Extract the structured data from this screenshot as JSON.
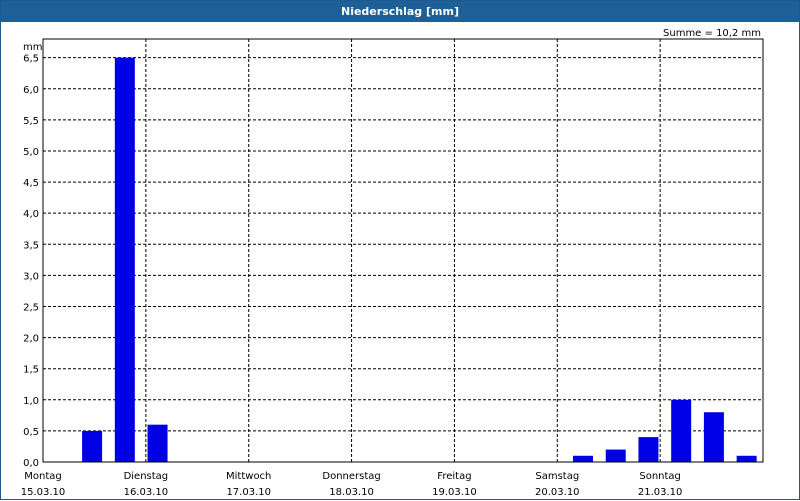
{
  "window": {
    "title": "Niederschlag [mm]"
  },
  "summary": "Summe = 10,2 mm",
  "colors": {
    "titlebar": "#1d5f96",
    "bar": "#0000e6",
    "grid": "#000000"
  },
  "chart_data": {
    "type": "bar",
    "title": "Niederschlag [mm]",
    "ylabel": "mm",
    "ylim": [
      0,
      6.8
    ],
    "grid": true,
    "y_ticks": [
      "0,0",
      "0,5",
      "1,0",
      "1,5",
      "2,0",
      "2,5",
      "3,0",
      "3,5",
      "4,0",
      "4,5",
      "5,0",
      "5,5",
      "6,0",
      "6,5"
    ],
    "days": [
      {
        "name": "Montag",
        "date": "15.03.10"
      },
      {
        "name": "Dienstag",
        "date": "16.03.10"
      },
      {
        "name": "Mittwoch",
        "date": "17.03.10"
      },
      {
        "name": "Donnerstag",
        "date": "18.03.10"
      },
      {
        "name": "Freitag",
        "date": "19.03.10"
      },
      {
        "name": "Samstag",
        "date": "20.03.10"
      },
      {
        "name": "Sonntag",
        "date": "21.03.10"
      }
    ],
    "series": [
      {
        "interval": "8h",
        "values": [
          0,
          0.5,
          6.5,
          0.6,
          0,
          0,
          0,
          0,
          0,
          0,
          0,
          0,
          0,
          0,
          0,
          0,
          0.1,
          0.2,
          0.4,
          1.0,
          0.8,
          0.1
        ]
      }
    ]
  }
}
